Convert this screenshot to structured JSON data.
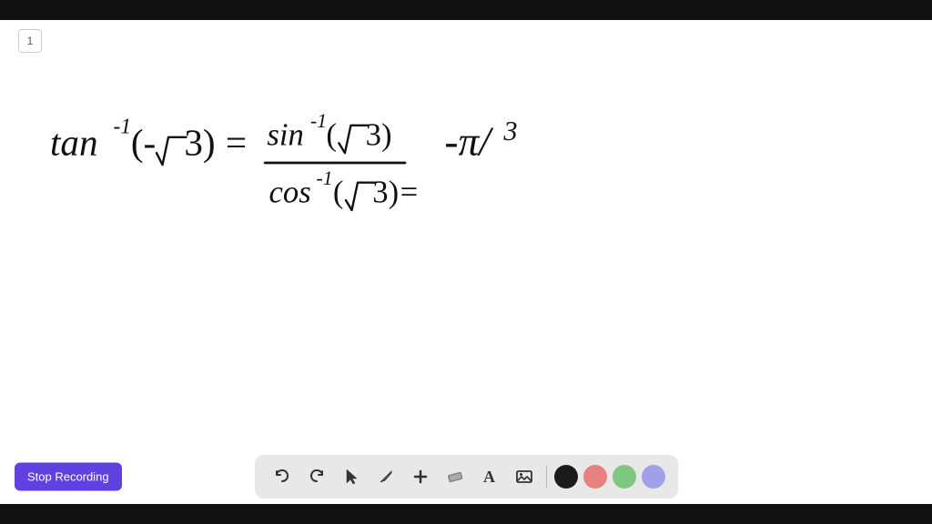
{
  "topBar": {
    "height": 22
  },
  "pageNumber": "1",
  "stopRecording": {
    "label": "Stop Recording"
  },
  "toolbar": {
    "tools": [
      {
        "name": "undo",
        "icon": "↺",
        "label": "Undo"
      },
      {
        "name": "redo",
        "icon": "↻",
        "label": "Redo"
      },
      {
        "name": "select",
        "icon": "▲",
        "label": "Select"
      },
      {
        "name": "pen",
        "icon": "✏",
        "label": "Pen"
      },
      {
        "name": "add",
        "icon": "+",
        "label": "Add"
      },
      {
        "name": "eraser",
        "icon": "◻",
        "label": "Eraser"
      },
      {
        "name": "text",
        "icon": "A",
        "label": "Text"
      },
      {
        "name": "image",
        "icon": "▣",
        "label": "Image"
      }
    ],
    "colors": [
      {
        "name": "black",
        "hex": "#1a1a1a"
      },
      {
        "name": "pink",
        "hex": "#e88080"
      },
      {
        "name": "green",
        "hex": "#80c880"
      },
      {
        "name": "lavender",
        "hex": "#a0a0e8"
      }
    ]
  }
}
